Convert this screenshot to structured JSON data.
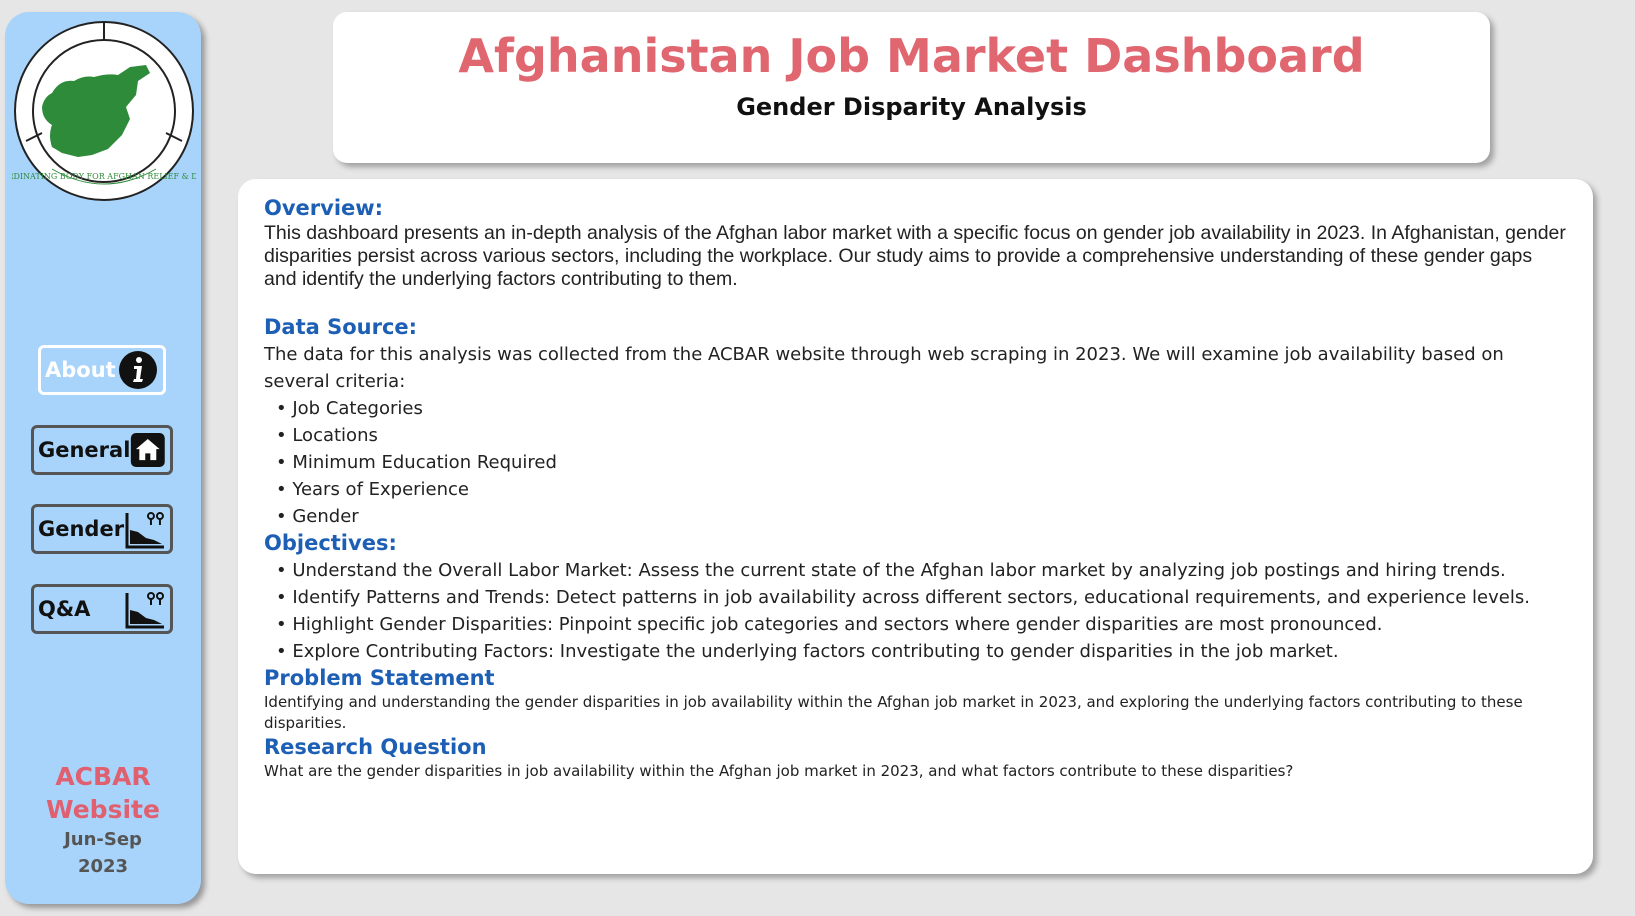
{
  "sidebar": {
    "logo_text": "AGENCY COORDINATING BODY FOR AFGHAN RELIEF & DEVELOPMENT",
    "nav": [
      {
        "label": "About",
        "icon": "info-icon"
      },
      {
        "label": "General",
        "icon": "home-icon"
      },
      {
        "label": "Gender",
        "icon": "gender-chart-icon"
      },
      {
        "label": "Q&A",
        "icon": "gender-chart-icon"
      }
    ],
    "brand_line1": "ACBAR",
    "brand_line2": "Website",
    "period_line1": "Jun-Sep",
    "period_line2": "2023"
  },
  "header": {
    "title": "Afghanistan Job Market Dashboard",
    "subtitle": "Gender Disparity Analysis"
  },
  "content": {
    "overview_heading": "Overview:",
    "overview_text": "This dashboard presents an in-depth analysis of the Afghan labor market with a specific focus on gender job availability in 2023. In Afghanistan, gender disparities persist across various sectors, including the workplace. Our study aims to provide a comprehensive understanding of these gender gaps and identify the underlying factors contributing to them.",
    "data_source_heading": "Data Source:",
    "data_source_text": "The data for this analysis was collected from the ACBAR website through web scraping in 2023. We will examine job availability based on several criteria:",
    "criteria": [
      "Job Categories",
      "Locations",
      "Minimum Education Required",
      "Years of Experience",
      "Gender"
    ],
    "objectives_heading": "Objectives:",
    "objectives": [
      "Understand the Overall Labor Market: Assess the current state of the Afghan labor market by analyzing job postings and hiring trends.",
      "Identify Patterns and Trends: Detect patterns in job availability across different sectors, educational requirements, and experience levels.",
      "Highlight Gender Disparities: Pinpoint specific job categories and sectors where gender disparities are most pronounced.",
      "Explore Contributing Factors: Investigate the underlying factors contributing to gender disparities in the job market."
    ],
    "problem_heading": "Problem Statement",
    "problem_text": "Identifying and understanding the gender disparities in job availability within the Afghan job market in 2023, and exploring the underlying factors contributing to these disparities.",
    "research_heading": "Research Question",
    "research_text": "What are the gender disparities in job availability within the Afghan job market in 2023, and what factors contribute to these disparities?"
  },
  "colors": {
    "title": "#e06670",
    "heading": "#1d5fb4",
    "sidebar": "#a8d4fb",
    "logo_green": "#2e8b3a"
  }
}
